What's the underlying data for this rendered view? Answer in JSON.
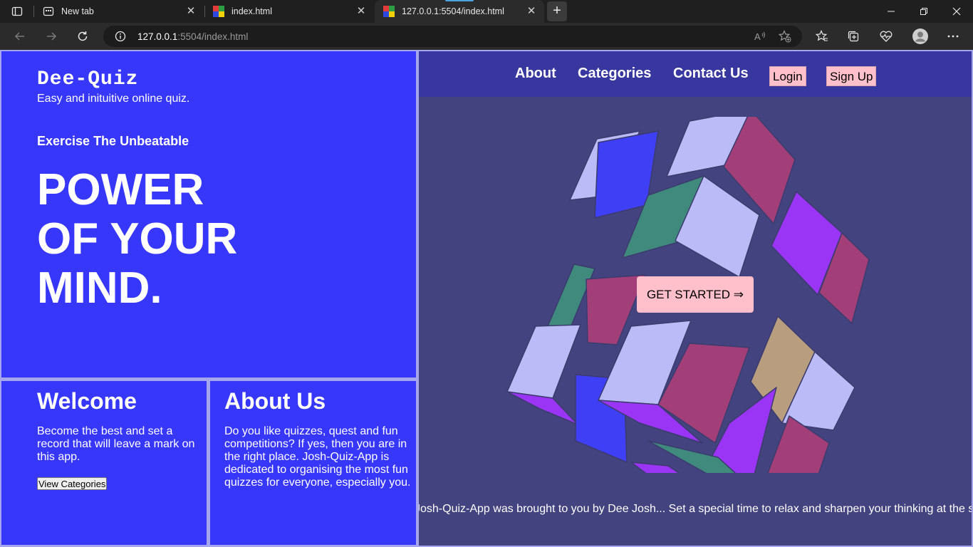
{
  "browser": {
    "tabs": [
      {
        "title": "New tab"
      },
      {
        "title": "index.html"
      },
      {
        "title": "127.0.0.1:5504/index.html",
        "active": true
      }
    ],
    "url_host": "127.0.0.1",
    "url_rest": ":5504/index.html",
    "icons": [
      "tab-actions-icon",
      "back-icon",
      "forward-icon",
      "refresh-icon",
      "info-icon",
      "read-aloud-icon",
      "add-favorite-icon",
      "favorites-icon",
      "collections-icon",
      "browser-essentials-icon",
      "profile-icon",
      "more-icon"
    ]
  },
  "site": {
    "brand": "Dee-Quiz",
    "tagline": "Easy and inituitive online quiz.",
    "kicker": "Exercise The Unbeatable",
    "headline": [
      "POWER",
      "OF YOUR",
      "MIND."
    ],
    "nav": {
      "about": "About",
      "categories": "Categories",
      "contact": "Contact Us",
      "login": "Login",
      "signup": "Sign Up"
    },
    "cta": "GET STARTED ⇒",
    "marquee": "Josh-Quiz-App was brought to you by Dee Josh... Set a special time to relax and sharpen your thinking at the s",
    "welcome": {
      "title": "Welcome",
      "body": "Become the best and set a record that will leave a mark on this app.",
      "button": "View Categories"
    },
    "about": {
      "title": "About Us",
      "body": "Do you like quizzes, quest and fun competitions? If yes, then you are in the right place. Josh-Quiz-App is dedicated to organising the most fun quizzes for everyone, especially you."
    }
  },
  "colors": {
    "panel_blue": "#3737fa",
    "border_lavender": "#a6a6ee",
    "right_bg": "#43437f",
    "nav_bg": "#37379f",
    "button_pink": "#ffc0cb",
    "cube_faces": [
      "#bbbbf7",
      "#a23f79",
      "#9b35f5",
      "#3f3ff5",
      "#3f8a7d",
      "#b89e7f"
    ]
  }
}
